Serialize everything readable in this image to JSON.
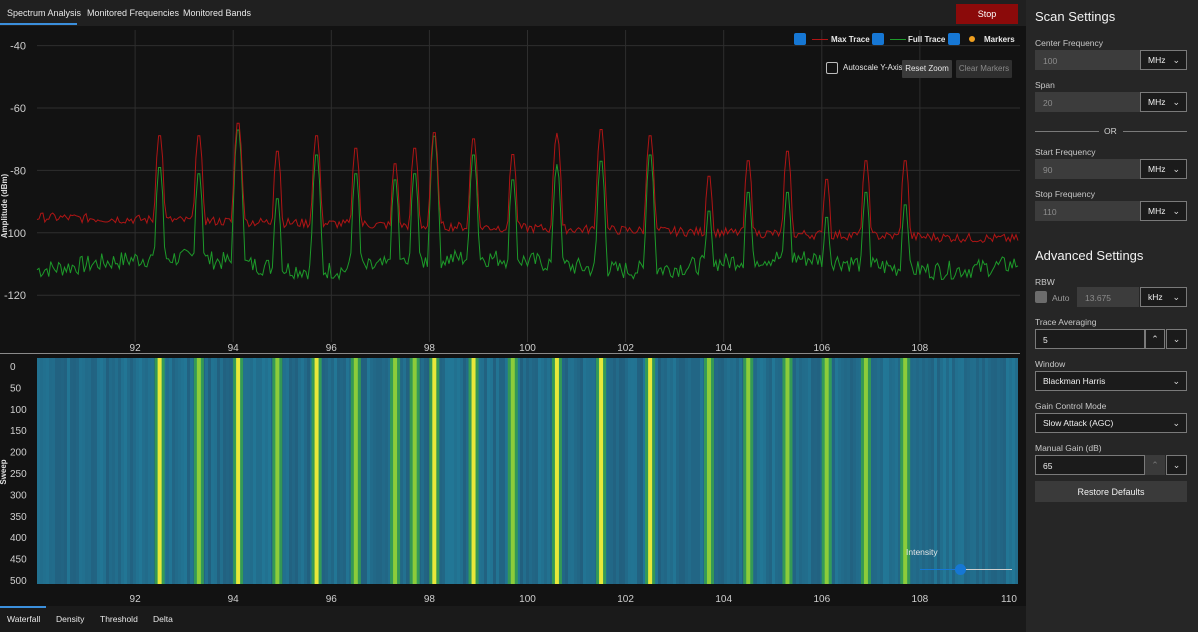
{
  "tabs_top": [
    "Spectrum Analysis",
    "Monitored Frequencies",
    "Monitored Bands"
  ],
  "stop_label": "Stop",
  "legend": {
    "max_trace": "Max Trace",
    "full_trace": "Full Trace",
    "markers": "Markers",
    "autoscale": "Autoscale Y-Axis",
    "reset_zoom": "Reset Zoom",
    "clear_markers": "Clear Markers"
  },
  "spectrum": {
    "ylabel": "Amplitude (dBm)",
    "yticks": [
      "-40",
      "-60",
      "-80",
      "-100",
      "-120"
    ],
    "xticks": [
      "92",
      "94",
      "96",
      "98",
      "100",
      "102",
      "104",
      "106",
      "108"
    ]
  },
  "waterfall": {
    "ylabel": "Sweep",
    "yticks": [
      "0",
      "50",
      "100",
      "150",
      "200",
      "250",
      "300",
      "350",
      "400",
      "450",
      "500"
    ],
    "xticks": [
      "92",
      "94",
      "96",
      "98",
      "100",
      "102",
      "104",
      "106",
      "108",
      "110"
    ],
    "intensity_label": "Intensity",
    "intensity_value": 0.43
  },
  "bottom_tabs": [
    "Waterfall",
    "Density",
    "Threshold",
    "Delta"
  ],
  "scan_settings": {
    "title": "Scan Settings",
    "center_label": "Center Frequency",
    "center_value": "100",
    "center_unit": "MHz",
    "span_label": "Span",
    "span_value": "20",
    "span_unit": "MHz",
    "or_text": "OR",
    "start_label": "Start Frequency",
    "start_value": "90",
    "start_unit": "MHz",
    "stop_label": "Stop Frequency",
    "stop_value": "110",
    "stop_unit": "MHz"
  },
  "advanced": {
    "title": "Advanced Settings",
    "rbw_label": "RBW",
    "rbw_auto": "Auto",
    "rbw_value": "13.675",
    "rbw_unit": "kHz",
    "trace_avg_label": "Trace Averaging",
    "trace_avg_value": "5",
    "window_label": "Window",
    "window_value": "Blackman Harris",
    "gain_mode_label": "Gain Control Mode",
    "gain_mode_value": "Slow Attack (AGC)",
    "manual_gain_label": "Manual Gain (dB)",
    "manual_gain_value": "65",
    "restore_label": "Restore Defaults"
  },
  "chart_data": {
    "type": "line",
    "ylabel": "Amplitude (dBm)",
    "xlim": [
      90,
      110
    ],
    "ylim": [
      -135,
      -35
    ],
    "peaks": [
      {
        "f": 92.5,
        "max": -68,
        "full": -78
      },
      {
        "f": 93.3,
        "max": -68,
        "full": -80
      },
      {
        "f": 94.1,
        "max": -64,
        "full": -66
      },
      {
        "f": 94.9,
        "max": -73,
        "full": -88
      },
      {
        "f": 95.7,
        "max": -68,
        "full": -74
      },
      {
        "f": 96.5,
        "max": -72,
        "full": -80
      },
      {
        "f": 97.3,
        "max": -77,
        "full": -82
      },
      {
        "f": 97.7,
        "max": -72,
        "full": -80
      },
      {
        "f": 98.1,
        "max": -67,
        "full": -68
      },
      {
        "f": 98.9,
        "max": -69,
        "full": -74
      },
      {
        "f": 99.7,
        "max": -74,
        "full": -82
      },
      {
        "f": 100.6,
        "max": -68,
        "full": -78
      },
      {
        "f": 101.5,
        "max": -66,
        "full": -76
      },
      {
        "f": 102.5,
        "max": -68,
        "full": -74
      },
      {
        "f": 103.7,
        "max": -81,
        "full": -92
      },
      {
        "f": 104.5,
        "max": -76,
        "full": -86
      },
      {
        "f": 105.3,
        "max": -73,
        "full": -86
      },
      {
        "f": 106.1,
        "max": -82,
        "full": -94
      },
      {
        "f": 106.9,
        "max": -76,
        "full": -86
      },
      {
        "f": 107.7,
        "max": -76,
        "full": -90
      }
    ],
    "max_trace_floor": -95,
    "full_trace_floor": -110,
    "colors": {
      "max": "#b01515",
      "full": "#1d9a2a"
    }
  }
}
